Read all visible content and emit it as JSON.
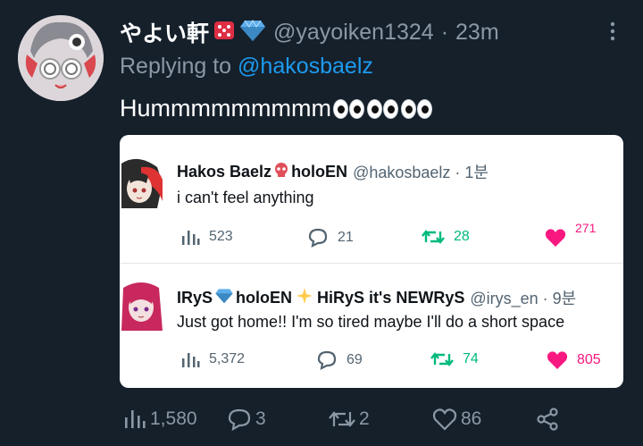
{
  "tweet": {
    "display_name": "やよい軒",
    "handle": "@yayoiken1324",
    "separator": "·",
    "time": "23m",
    "reply_prefix": "Replying to",
    "reply_to": "@hakosbaelz",
    "text": "Hummmmmmmmm"
  },
  "quoted": [
    {
      "name_a": "Hakos Baelz",
      "name_b": "holoEN",
      "handle": "@hakosbaelz · 1분",
      "text": "i can't feel anything",
      "views": "523",
      "replies": "21",
      "retweets": "28",
      "likes": "271"
    },
    {
      "name_a": "IRyS",
      "name_b": "holoEN",
      "name_c": "HiRyS it's NEWRyS",
      "handle": "@irys_en · 9분",
      "text": "Just got home!! I'm so tired maybe I'll do a short space",
      "views": "5,372",
      "replies": "69",
      "retweets": "74",
      "likes": "805"
    }
  ],
  "actions": {
    "views": "1,580",
    "replies": "3",
    "retweets": "2",
    "likes": "86"
  },
  "colors": {
    "background": "#15202b",
    "link": "#1d9bf0",
    "muted": "#8b98a5",
    "retweet": "#00ba7c",
    "like": "#f91880"
  },
  "icons": [
    "die-emoji",
    "gem-emoji",
    "more-icon",
    "views-icon",
    "reply-icon",
    "retweet-icon",
    "like-icon",
    "share-icon",
    "eyes-emoji",
    "skull-emoji",
    "sparkles-emoji"
  ]
}
